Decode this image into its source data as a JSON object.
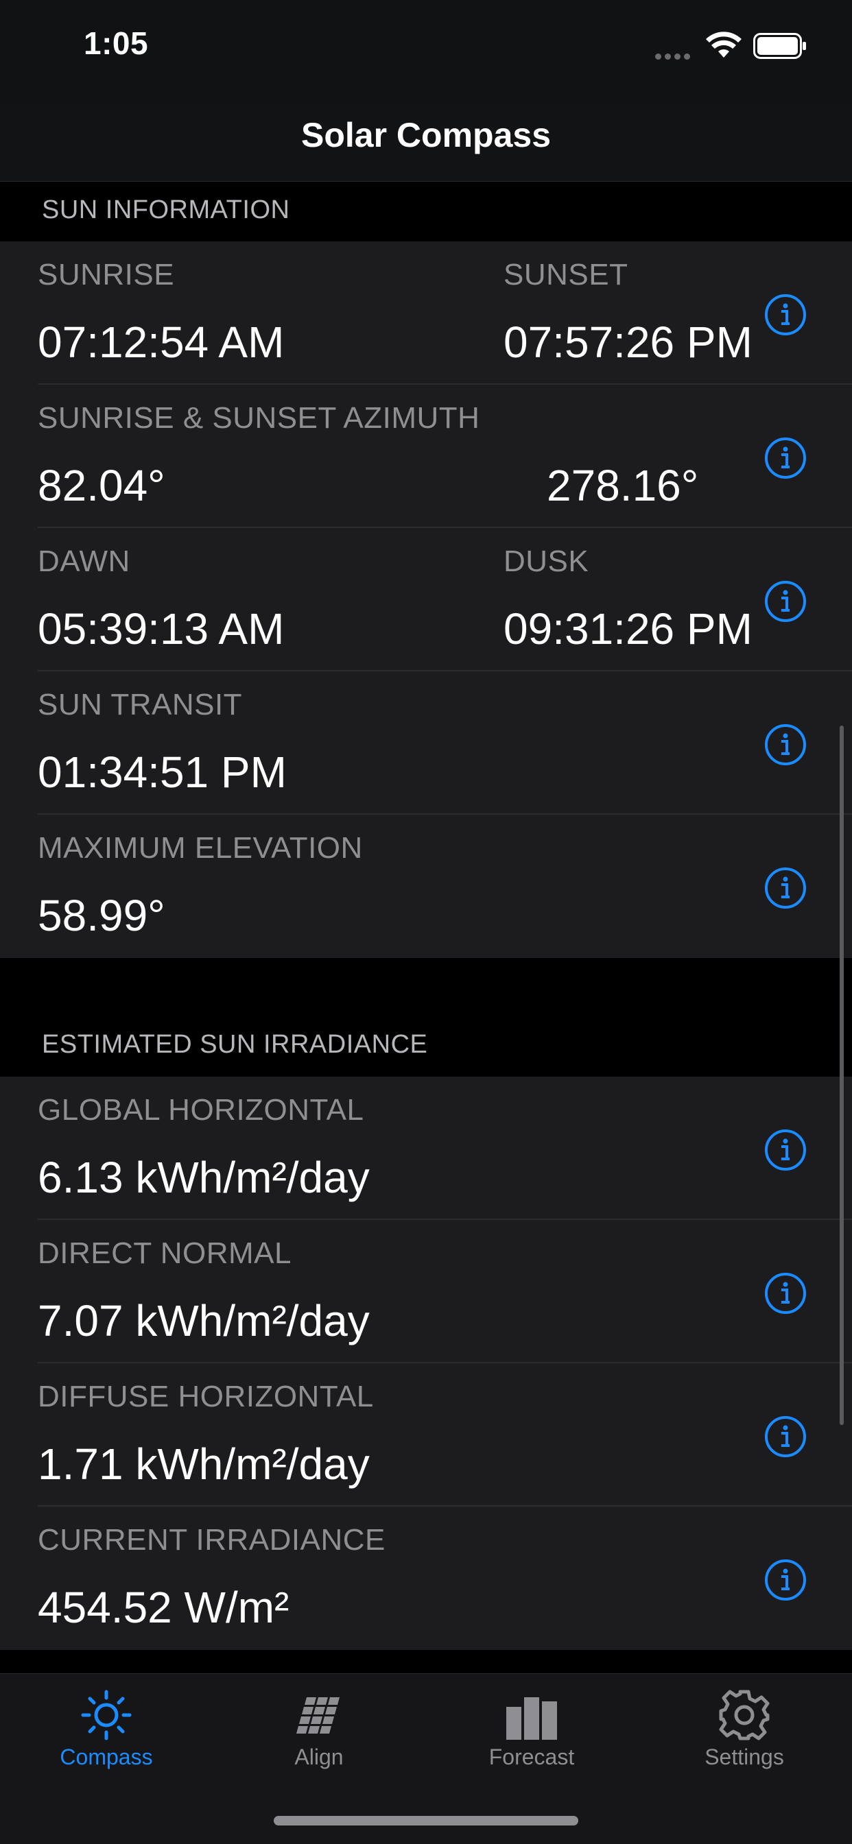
{
  "status_bar": {
    "time": "1:05"
  },
  "nav": {
    "title": "Solar Compass"
  },
  "sections": {
    "sun_info": {
      "title": "SUN INFORMATION"
    },
    "irradiance": {
      "title": "ESTIMATED SUN IRRADIANCE"
    }
  },
  "sun_info": {
    "sunrise_label": "SUNRISE",
    "sunrise_value": "07:12:54 AM",
    "sunset_label": "SUNSET",
    "sunset_value": "07:57:26 PM",
    "azimuth_label": "SUNRISE & SUNSET AZIMUTH",
    "azimuth_sunrise": "82.04°",
    "azimuth_sunset": "278.16°",
    "dawn_label": "DAWN",
    "dawn_value": "05:39:13 AM",
    "dusk_label": "DUSK",
    "dusk_value": "09:31:26 PM",
    "transit_label": "SUN TRANSIT",
    "transit_value": "01:34:51 PM",
    "max_elev_label": "MAXIMUM ELEVATION",
    "max_elev_value": "58.99°"
  },
  "irradiance": {
    "ghi_label": "GLOBAL HORIZONTAL",
    "ghi_value": "6.13 kWh/m²/day",
    "dni_label": "DIRECT NORMAL",
    "dni_value": "7.07 kWh/m²/day",
    "dhi_label": "DIFFUSE HORIZONTAL",
    "dhi_value": "1.71 kWh/m²/day",
    "current_label": "CURRENT IRRADIANCE",
    "current_value": "454.52 W/m²"
  },
  "tabs": [
    {
      "label": "Compass",
      "icon": "sun-icon",
      "active": true
    },
    {
      "label": "Align",
      "icon": "solar-panel-icon",
      "active": false
    },
    {
      "label": "Forecast",
      "icon": "bar-chart-icon",
      "active": false
    },
    {
      "label": "Settings",
      "icon": "gear-icon",
      "active": false
    }
  ],
  "colors": {
    "accent": "#1a8cff",
    "row_bg": "#1c1c1e",
    "label": "#8e8e93"
  }
}
